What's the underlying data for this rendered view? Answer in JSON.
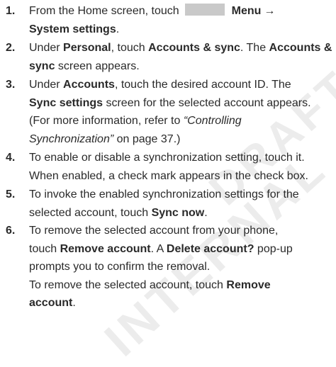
{
  "watermark": {
    "line1": "DRAFT",
    "line2": "INTERNAL"
  },
  "steps": [
    {
      "number": "1.",
      "lines": [
        {
          "t1": "From the Home screen, touch",
          "key": "menu-key",
          "t2": "Menu",
          "arrow": "→"
        },
        {
          "t1": "System settings",
          "t2": "."
        }
      ]
    },
    {
      "number": "2.",
      "lines": [
        {
          "t1": "Under ",
          "t2": "Personal",
          "t3": ", touch ",
          "t4": "Accounts & sync",
          "t5": ". The ",
          "t6": "Accounts &"
        },
        {
          "t1": "sync",
          "t2": " screen appears."
        }
      ]
    },
    {
      "number": "3.",
      "lines": [
        {
          "t1": "Under ",
          "t2": "Accounts",
          "t3": ", touch the desired account ID. The"
        },
        {
          "t1": "Sync settings",
          "t2": " screen for the selected account appears."
        },
        {
          "t1": "(For more information, refer to ",
          "t2": "“Controlling"
        },
        {
          "t1": "Synchronization”",
          "t2": " on page 37.)"
        }
      ]
    },
    {
      "number": "4.",
      "lines": [
        {
          "t1": "To enable or disable a synchronization setting, touch it."
        },
        {
          "t1": "When enabled, a check mark appears in the check box."
        }
      ]
    },
    {
      "number": "5.",
      "lines": [
        {
          "t1": "To invoke the enabled synchronization settings for the"
        },
        {
          "t1": "selected account, touch ",
          "t2": "Sync now",
          "t3": "."
        }
      ]
    },
    {
      "number": "6.",
      "lines": [
        {
          "t1": "To remove the selected account from your phone,"
        },
        {
          "t1": "touch ",
          "t2": "Remove account",
          "t3": ". A ",
          "t4": "Delete account?",
          "t5": " pop-up"
        },
        {
          "t1": "prompts you to confirm the removal."
        },
        {
          "t1": "To remove the selected account, touch ",
          "t2": "Remove"
        },
        {
          "t1": "account",
          "t2": "."
        }
      ]
    }
  ]
}
